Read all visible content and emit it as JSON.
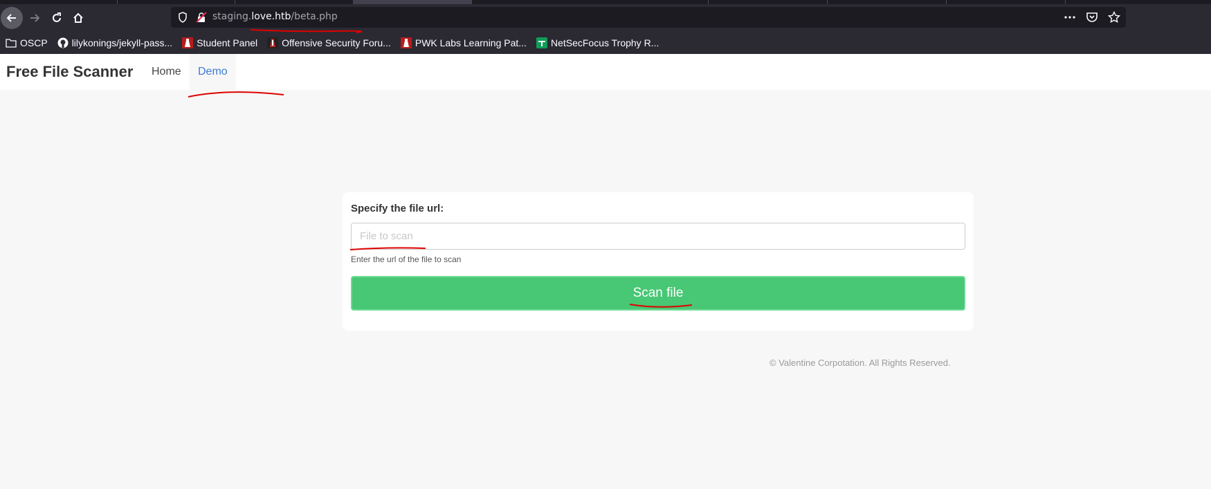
{
  "browser": {
    "url_prefix": "staging.",
    "url_host": "love.htb",
    "url_path": "/beta.php",
    "bookmarks": [
      {
        "label": "OSCP",
        "icon": "folder-icon"
      },
      {
        "label": "lilykonings/jekyll-pass...",
        "icon": "github-icon"
      },
      {
        "label": "Student Panel",
        "icon": "offsec-icon"
      },
      {
        "label": "Offensive Security Foru...",
        "icon": "offsec-forum-icon"
      },
      {
        "label": "PWK Labs Learning Pat...",
        "icon": "offsec-icon"
      },
      {
        "label": "NetSecFocus Trophy R...",
        "icon": "sheets-icon"
      }
    ]
  },
  "navbar": {
    "brand": "Free File Scanner",
    "links": [
      "Home",
      "Demo"
    ]
  },
  "form": {
    "label": "Specify the file url:",
    "input_value": "",
    "input_placeholder": "File to scan",
    "help": "Enter the url of the file to scan",
    "button": "Scan file"
  },
  "footer": "© Valentine Corpotation. All Rights Reserved.",
  "colors": {
    "button": "#48c774",
    "active_link": "#3a7bd5",
    "annotation": "#e00000"
  }
}
